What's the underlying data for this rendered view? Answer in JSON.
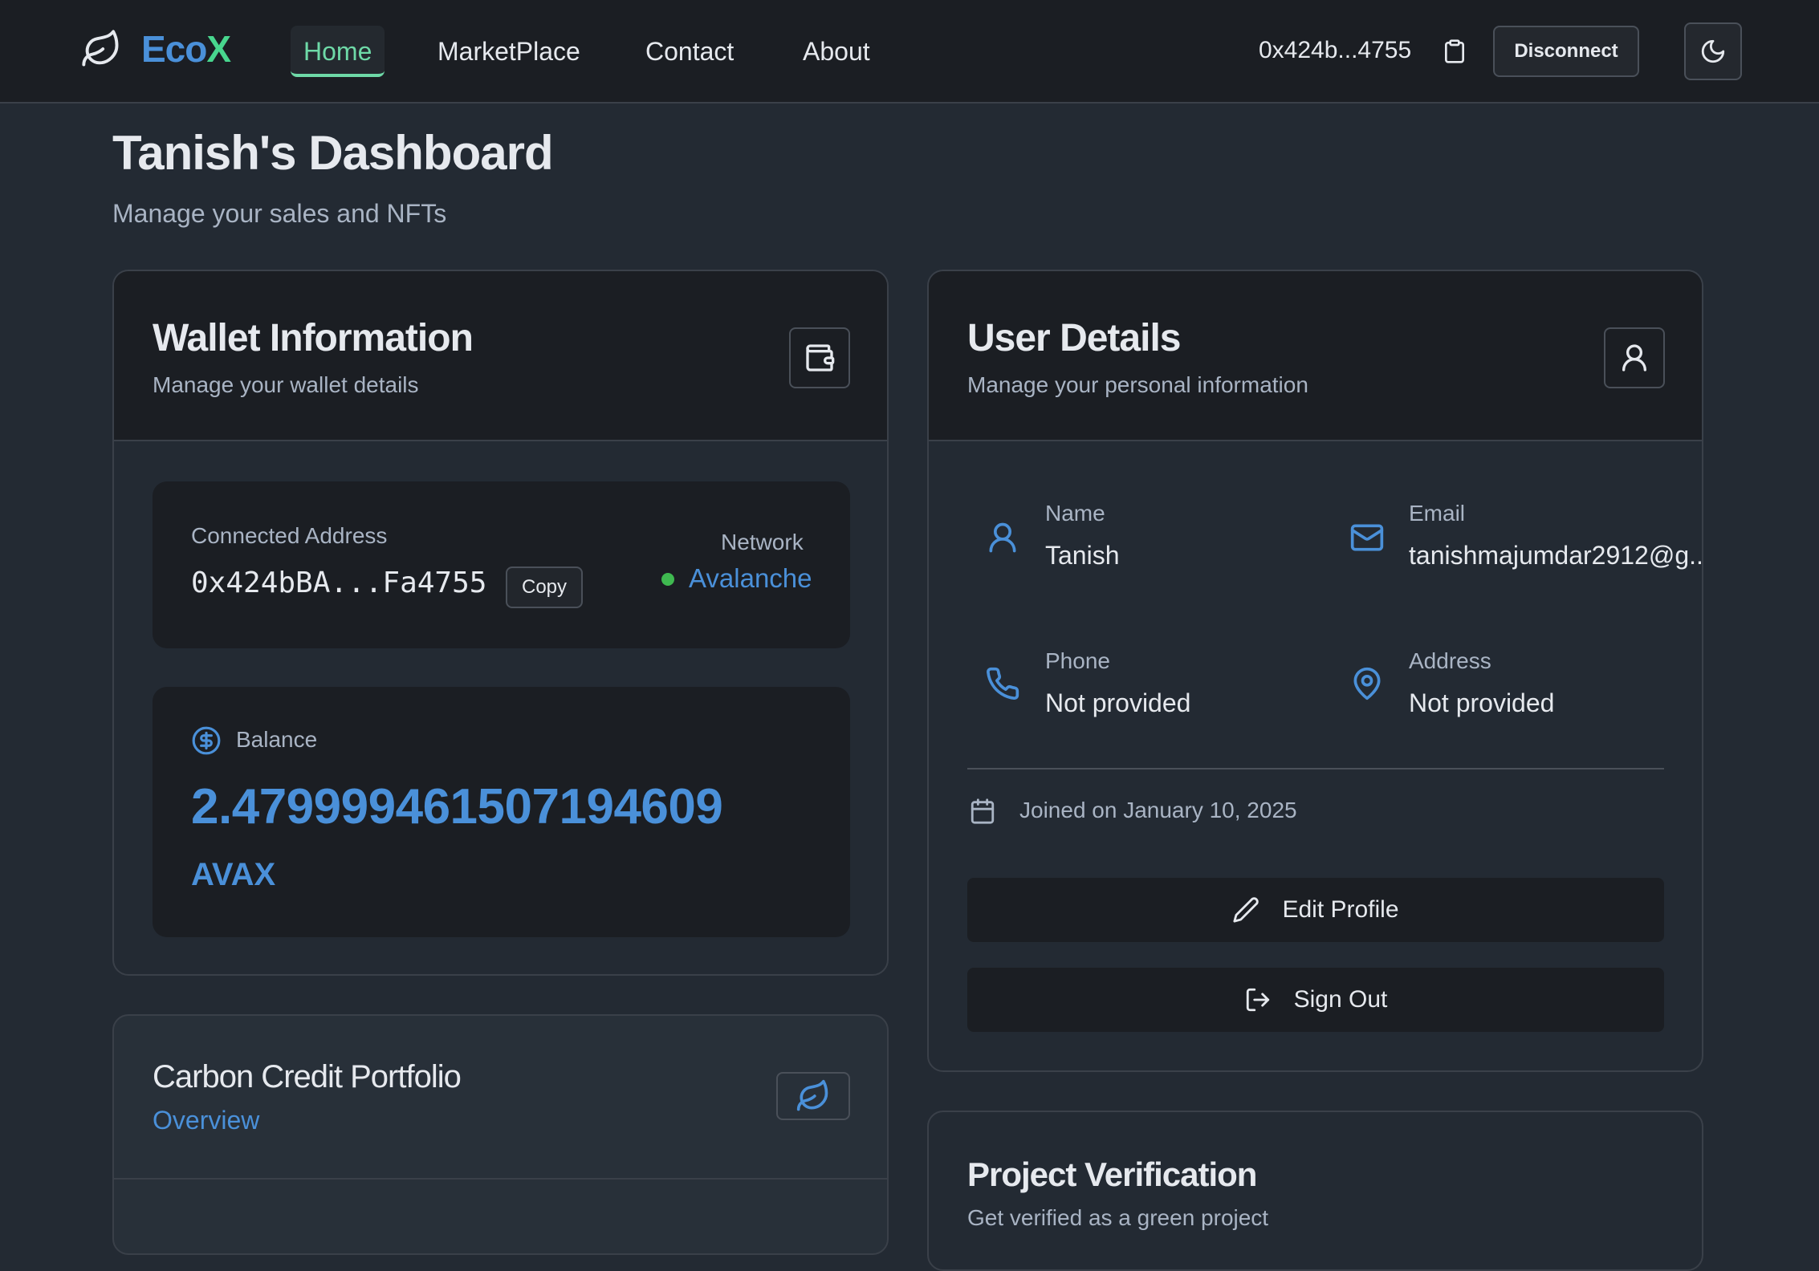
{
  "nav": {
    "brand_eco": "Eco",
    "brand_x": "X",
    "links": [
      "Home",
      "MarketPlace",
      "Contact",
      "About"
    ],
    "wallet_short": "0x424b...4755",
    "disconnect_label": "Disconnect"
  },
  "page": {
    "title": "Tanish's Dashboard",
    "subtitle": "Manage your sales and NFTs"
  },
  "wallet": {
    "title": "Wallet Information",
    "subtitle": "Manage your wallet details",
    "address_label": "Connected Address",
    "address": "0x424bBA...Fa4755",
    "copy_label": "Copy",
    "network_label": "Network",
    "network_value": "Avalanche",
    "balance_label": "Balance",
    "balance_value": "2.479999461507194609",
    "balance_unit": "AVAX"
  },
  "user": {
    "title": "User Details",
    "subtitle": "Manage your personal information",
    "name_label": "Name",
    "name_value": "Tanish",
    "email_label": "Email",
    "email_value": "tanishmajumdar2912@g...",
    "phone_label": "Phone",
    "phone_value": "Not provided",
    "address_label": "Address",
    "address_value": "Not provided",
    "joined": "Joined on January 10, 2025",
    "edit_label": "Edit Profile",
    "signout_label": "Sign Out"
  },
  "carbon": {
    "title": "Carbon Credit Portfolio",
    "subtitle": "Overview"
  },
  "verify": {
    "title": "Project Verification",
    "subtitle": "Get verified as a green project"
  },
  "colors": {
    "accent_blue": "#4a90d9",
    "accent_green": "#48d68e",
    "active_nav": "#6ed9a7",
    "network_dot": "#3fb950"
  }
}
